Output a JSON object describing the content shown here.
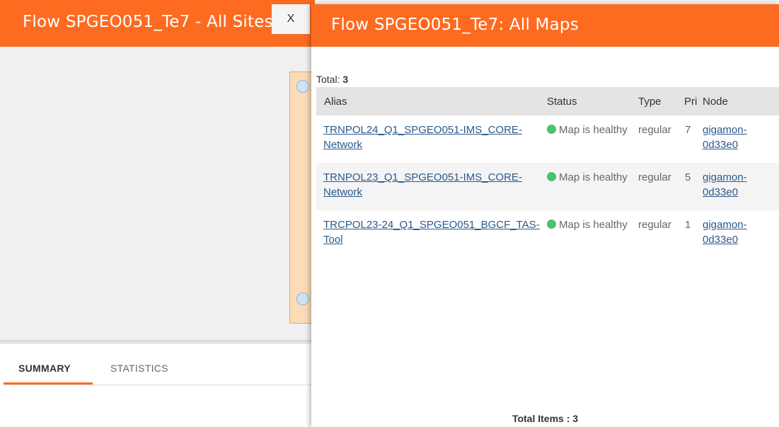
{
  "background": {
    "title": "Flow SPGEO051_Te7 - All Sites",
    "tabs": [
      {
        "label": "SUMMARY",
        "active": true
      },
      {
        "label": "STATISTICS",
        "active": false
      }
    ]
  },
  "close_label": "X",
  "drawer": {
    "title": "Flow SPGEO051_Te7: All Maps",
    "total_label": "Total:",
    "total_value": "3",
    "columns": [
      "Alias",
      "Status",
      "Type",
      "Pri",
      "Node"
    ],
    "rows": [
      {
        "alias": "TRNPOL24_Q1_SPGEO051-IMS_CORE-Network",
        "status": "Map is healthy",
        "type": "regular",
        "pri": "7",
        "node": "gigamon-0d33e0"
      },
      {
        "alias": "TRNPOL23_Q1_SPGEO051-IMS_CORE-Network",
        "status": "Map is healthy",
        "type": "regular",
        "pri": "5",
        "node": "gigamon-0d33e0"
      },
      {
        "alias": "TRCPOL23-24_Q1_SPGEO051_BGCF_TAS-Tool",
        "status": "Map is healthy",
        "type": "regular",
        "pri": "1",
        "node": "gigamon-0d33e0"
      }
    ],
    "total_items": "Total Items : 3"
  },
  "colors": {
    "accent": "#fd6b21",
    "status_healthy": "#4dc072",
    "link": "#2a5a8a"
  }
}
